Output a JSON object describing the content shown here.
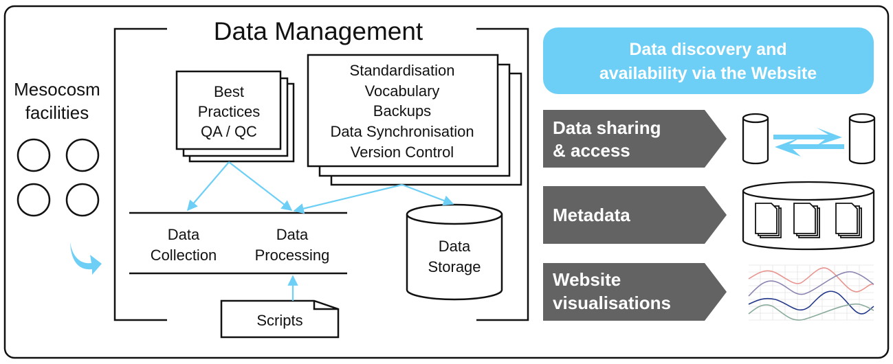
{
  "title": "Data Management",
  "left": {
    "label_lines": [
      "Mesocosm",
      "facilities"
    ],
    "facility_count": 4
  },
  "management": {
    "best_practices": [
      "Best",
      "Practices",
      "QA / QC"
    ],
    "standards": [
      "Standardisation",
      "Vocabulary",
      "Backups",
      "Data Synchronisation",
      "Version Control"
    ],
    "collection": [
      "Data",
      "Collection"
    ],
    "processing": [
      "Data",
      "Processing"
    ],
    "storage": [
      "Data",
      "Storage"
    ],
    "scripts": "Scripts"
  },
  "right": {
    "header_lines": [
      "Data discovery and",
      "availability via the Website"
    ],
    "rows": [
      {
        "lines": [
          "Data sharing",
          "& access"
        ],
        "icon": "database-exchange-icon"
      },
      {
        "lines": [
          "Metadata"
        ],
        "icon": "metadata-documents-icon"
      },
      {
        "lines": [
          "Website",
          "visualisations"
        ],
        "icon": "line-chart-icon"
      }
    ]
  },
  "colors": {
    "accent": "#6dcff6",
    "arrow": "#6dcff6",
    "banner": "#636363",
    "stroke": "#111111"
  }
}
